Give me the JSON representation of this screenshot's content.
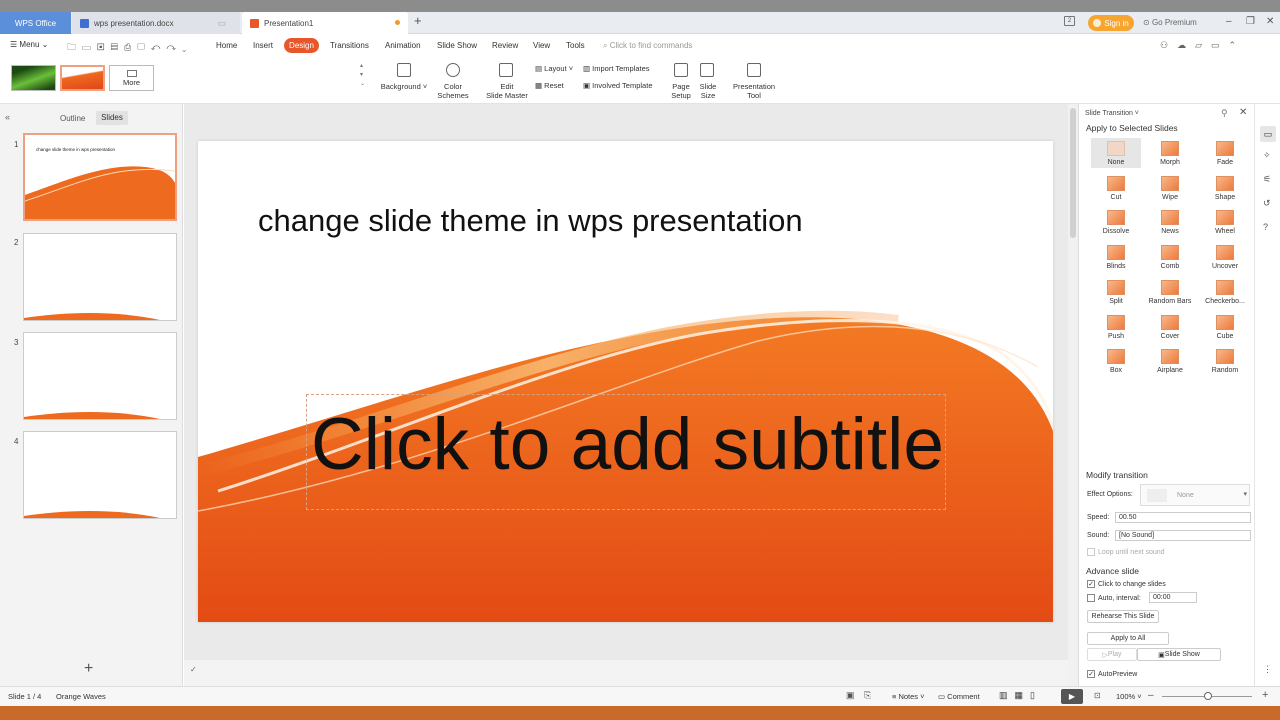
{
  "tabs": {
    "wps": "WPS Office",
    "doc": "wps presentation.docx",
    "ppt": "Presentation1"
  },
  "header": {
    "sign_in": "Sign in",
    "premium": "Go Premium"
  },
  "menu": {
    "menu_label": "Menu",
    "items": [
      "Home",
      "Insert",
      "Design",
      "Transitions",
      "Animation",
      "Slide Show",
      "Review",
      "View",
      "Tools"
    ],
    "find": "Click to find commands"
  },
  "ribbon": {
    "more": "More",
    "background": "Background",
    "color_schemes": "Color\nSchemes",
    "edit_master": "Edit\nSlide Master",
    "layout": "Layout",
    "reset": "Reset",
    "import_templates": "Import Templates",
    "involved_template": "Involved Template",
    "page_setup": "Page\nSetup",
    "slide_size": "Slide\nSize",
    "presentation_tool": "Presentation\nTool"
  },
  "sidepanel": {
    "outline": "Outline",
    "slides": "Slides",
    "thumb1_title": "change slide theme in wps presentation",
    "numbers": [
      "1",
      "2",
      "3",
      "4"
    ]
  },
  "slide": {
    "title": "change slide theme in wps presentation",
    "subtitle": "Click to add subtitle"
  },
  "transition_panel": {
    "header": "Slide Transition",
    "apply_selected": "Apply to Selected Slides",
    "effects": [
      "None",
      "Morph",
      "Fade",
      "Cut",
      "Wipe",
      "Shape",
      "Dissolve",
      "News",
      "Wheel",
      "Blinds",
      "Comb",
      "Uncover",
      "Split",
      "Random Bars",
      "Checkerbo...",
      "Push",
      "Cover",
      "Cube",
      "Box",
      "Airplane",
      "Random"
    ],
    "modify": "Modify transition",
    "effect_options": "Effect Options:",
    "effect_value": "None",
    "speed_label": "Speed:",
    "speed_value": "00.50",
    "sound_label": "Sound:",
    "sound_value": "[No Sound]",
    "loop": "Loop until next sound",
    "advance": "Advance slide",
    "click_change": "Click to change slides",
    "auto_interval": "Auto, interval:",
    "interval_value": "00:00",
    "rehearse": "Rehearse This Slide",
    "apply_all": "Apply to All",
    "play": "Play",
    "slide_show": "Slide Show",
    "autopreview": "AutoPreview"
  },
  "status": {
    "slide_count": "Slide 1 / 4",
    "theme": "Orange Waves",
    "notes": "Notes",
    "comment": "Comment",
    "zoom": "100%"
  },
  "colors": {
    "accent": "#e8572a",
    "wave_orange": "#ee6a1f"
  }
}
